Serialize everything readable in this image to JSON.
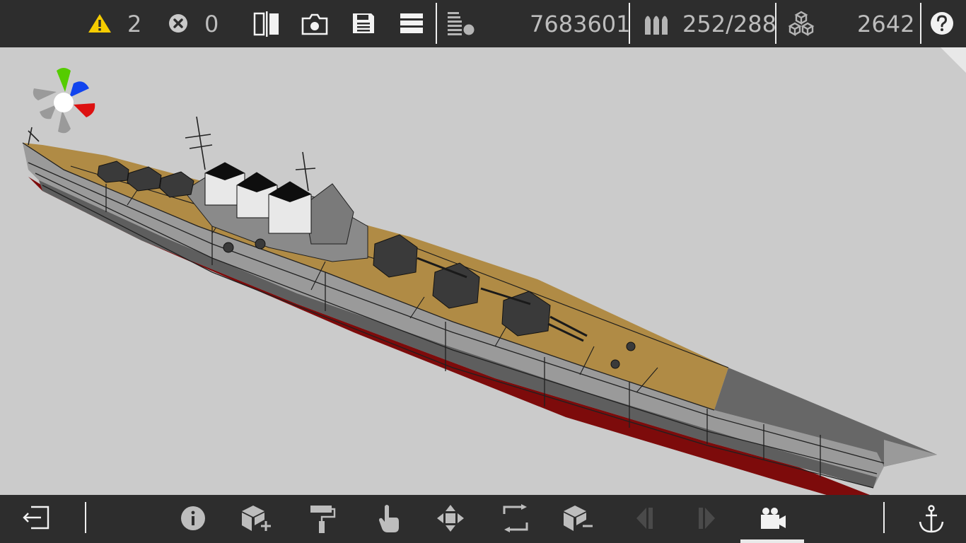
{
  "toolbar": {
    "warnings": {
      "icon": "warning-icon",
      "count": "2",
      "color": "#f5cc00"
    },
    "errors": {
      "icon": "error-icon",
      "count": "0"
    },
    "mirror_icon": "mirror-icon",
    "screenshot_icon": "camera-icon",
    "save_icon": "save-icon",
    "layers_icon": "layers-icon",
    "stats": [
      {
        "icon": "weight-icon",
        "value": "7683601"
      },
      {
        "icon": "ammo-icon",
        "value": "252/288"
      },
      {
        "icon": "blocks-icon",
        "value": "2642"
      }
    ],
    "help_icon": "help-icon"
  },
  "bottom_toolbar": {
    "exit_icon": "exit-icon",
    "tools": [
      {
        "name": "info-icon",
        "active": false
      },
      {
        "name": "add-block-icon",
        "active": false
      },
      {
        "name": "paint-roller-icon",
        "active": false
      },
      {
        "name": "touch-select-icon",
        "active": false
      },
      {
        "name": "move-icon",
        "active": false
      },
      {
        "name": "rotate-icon",
        "active": false
      },
      {
        "name": "remove-block-icon",
        "active": false
      },
      {
        "name": "previous-icon",
        "active": false
      },
      {
        "name": "next-icon",
        "active": false
      },
      {
        "name": "camera-view-icon",
        "active": true
      }
    ],
    "anchor_icon": "anchor-icon"
  },
  "colors": {
    "bar": "#2d2d2d",
    "viewport": "#cbcbcb",
    "deck": "#b08b45",
    "hull_grey": "#8f8f8f",
    "hull_red": "#8a0f0f",
    "axis_green": "#55cc00",
    "axis_blue": "#1144ee",
    "axis_red": "#dd1111"
  }
}
